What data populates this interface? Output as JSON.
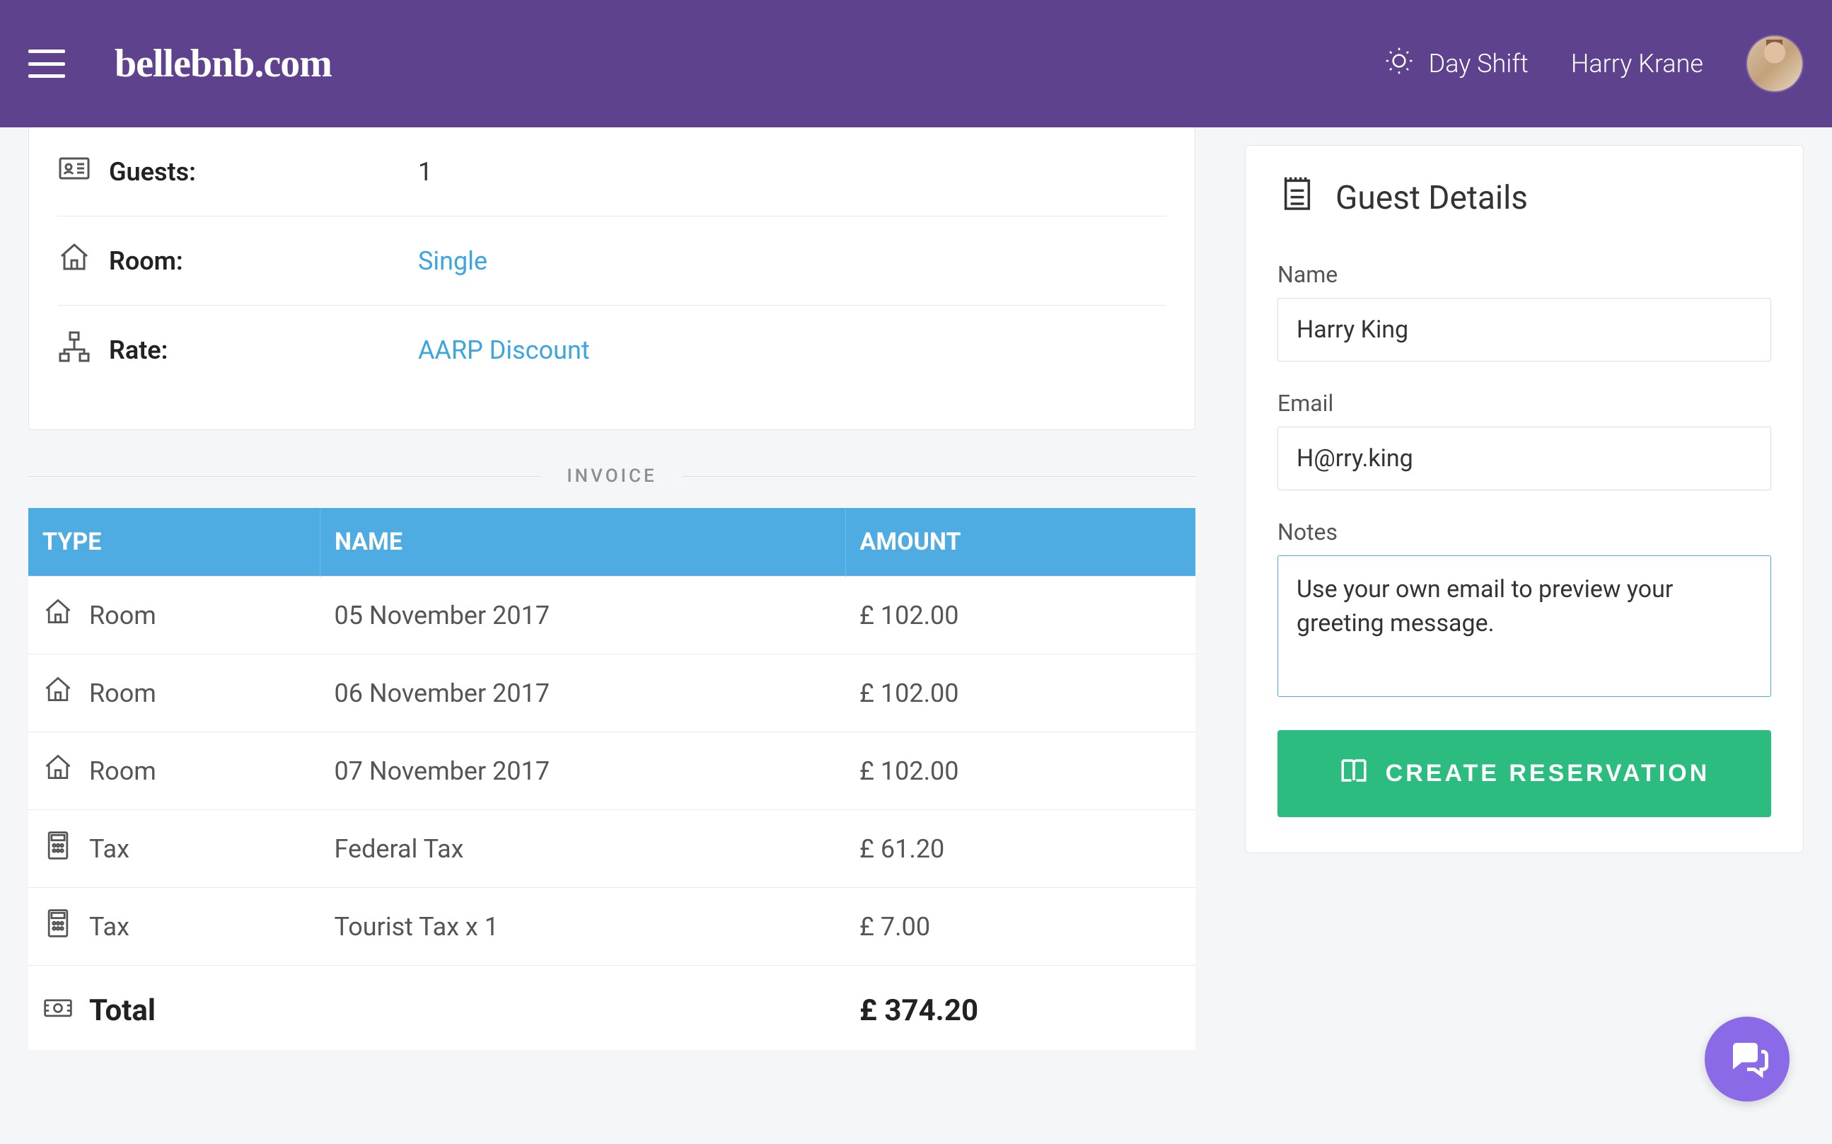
{
  "header": {
    "brand": "bellebnb.com",
    "shift_label": "Day Shift",
    "user_name": "Harry Krane"
  },
  "booking": {
    "guests_label": "Guests:",
    "guests_value": "1",
    "room_label": "Room:",
    "room_value": "Single",
    "rate_label": "Rate:",
    "rate_value": "AARP Discount"
  },
  "invoice": {
    "divider": "INVOICE",
    "columns": {
      "type": "TYPE",
      "name": "NAME",
      "amount": "AMOUNT"
    },
    "rows": [
      {
        "icon": "home",
        "type": "Room",
        "name": "05 November 2017",
        "amount": "£ 102.00"
      },
      {
        "icon": "home",
        "type": "Room",
        "name": "06 November 2017",
        "amount": "£ 102.00"
      },
      {
        "icon": "home",
        "type": "Room",
        "name": "07 November 2017",
        "amount": "£ 102.00"
      },
      {
        "icon": "calculator",
        "type": "Tax",
        "name": "Federal Tax",
        "amount": "£ 61.20"
      },
      {
        "icon": "calculator",
        "type": "Tax",
        "name": "Tourist Tax x 1",
        "amount": "£ 7.00"
      }
    ],
    "total": {
      "icon": "cash",
      "label": "Total",
      "amount": "£ 374.20"
    }
  },
  "guest_panel": {
    "title": "Guest Details",
    "name_label": "Name",
    "name_value": "Harry King",
    "email_label": "Email",
    "email_value": "H@rry.king",
    "notes_label": "Notes",
    "notes_value": "Use your own email to preview your greeting message.",
    "create_label": "CREATE RESERVATION"
  },
  "colors": {
    "header_bg": "#5e428e",
    "accent_blue": "#4face2",
    "link_blue": "#3aa5df",
    "success_green": "#2dbc7f",
    "fab_purple": "#8a6ae6"
  }
}
